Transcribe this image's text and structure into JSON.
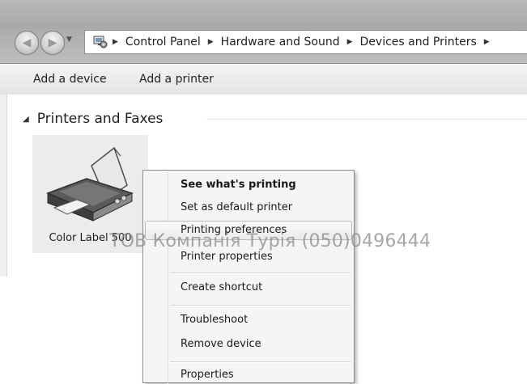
{
  "breadcrumbs": [
    "Control Panel",
    "Hardware and Sound",
    "Devices and Printers"
  ],
  "toolbar": {
    "add_device": "Add a device",
    "add_printer": "Add a printer"
  },
  "group": {
    "title": "Printers and Faxes"
  },
  "device": {
    "name": "Color Label 500",
    "icon": "printer-icon"
  },
  "context_menu": {
    "items": [
      "See what's printing",
      "Set as default printer",
      "Printing preferences",
      "Printer properties",
      "Create shortcut",
      "Troubleshoot",
      "Remove device",
      "Properties"
    ],
    "default_item": "See what's printing",
    "hovered_item": "Printing preferences"
  },
  "watermark": "ТОВ Компанія Турія (050)0496444"
}
